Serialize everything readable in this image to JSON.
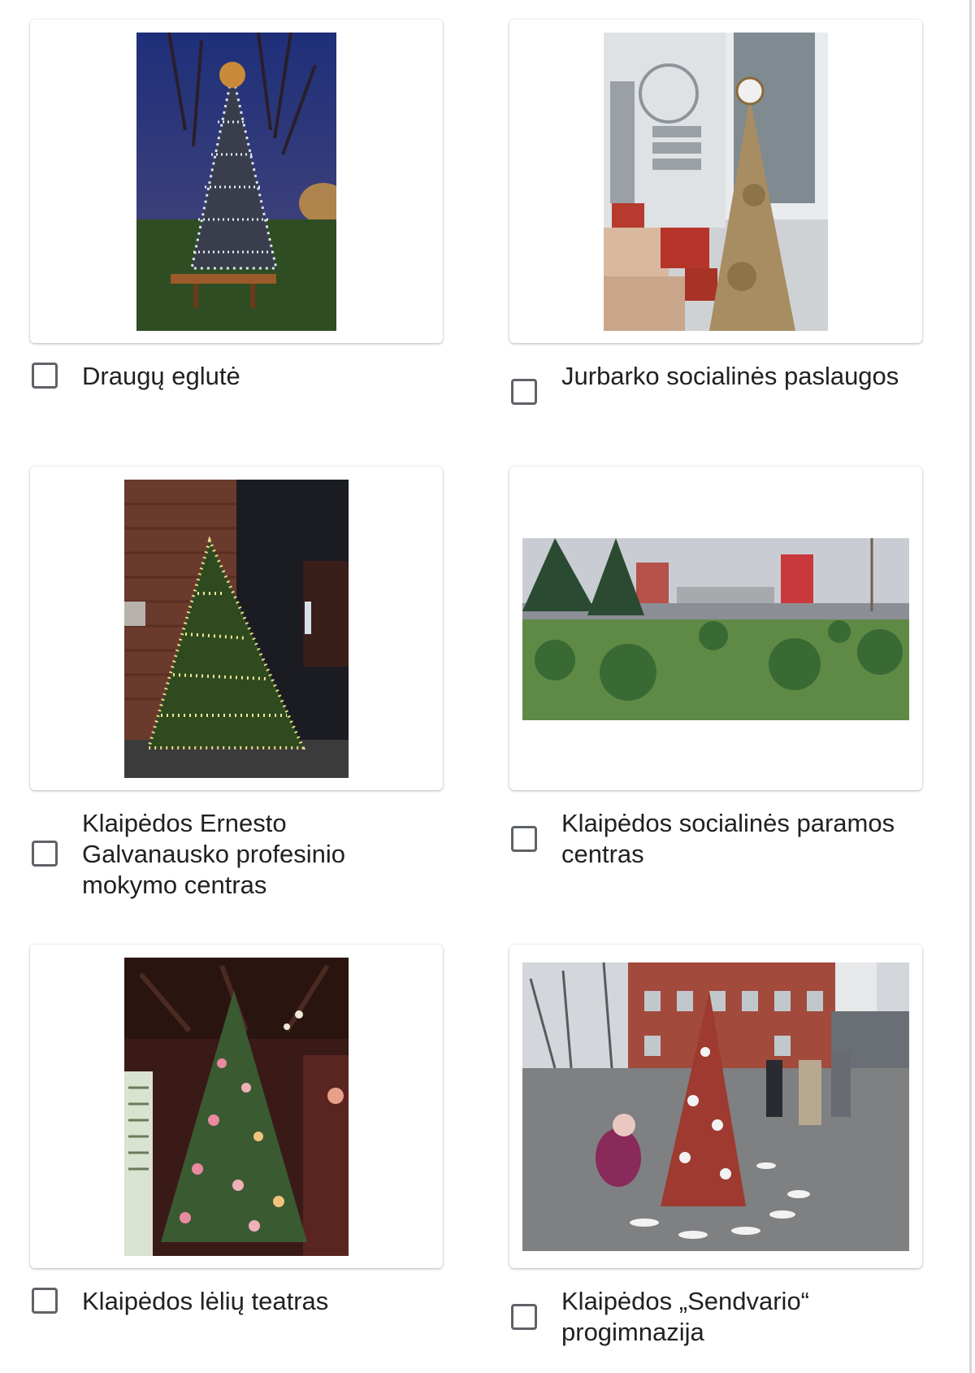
{
  "options": [
    {
      "label": "Draugų eglutė",
      "checked": false
    },
    {
      "label": "Jurbarko socialinės paslaugos",
      "checked": false
    },
    {
      "label": "Klaipėdos Ernesto Galvanausko profesinio mokymo centras",
      "checked": false
    },
    {
      "label": "Klaipėdos socialinės paramos centras",
      "checked": false
    },
    {
      "label": "Klaipėdos lėlių teatras",
      "checked": false
    },
    {
      "label": "Klaipėdos „Sendvario“ progimnazija",
      "checked": false
    }
  ],
  "colors": {
    "checkbox_border": "#5f6368",
    "text": "#202124",
    "card_background": "#ffffff"
  }
}
